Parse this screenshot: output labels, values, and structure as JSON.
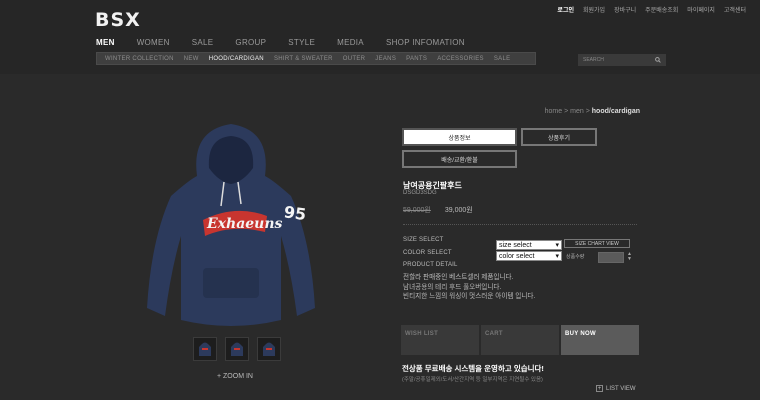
{
  "brand": "BSX",
  "util_links": [
    "로그인",
    "회원가입",
    "장바구니",
    "주문배송조회",
    "마이페이지",
    "고객센터"
  ],
  "main_nav": [
    "MEN",
    "WOMEN",
    "SALE",
    "GROUP",
    "STYLE",
    "MEDIA",
    "SHOP INFOMATION"
  ],
  "main_nav_active": "MEN",
  "sub_nav": [
    "WINTER COLLECTION",
    "NEW",
    "HOOD/CARDIGAN",
    "SHIRT & SWEATER",
    "OUTER",
    "JEANS",
    "PANTS",
    "ACCESSORIES",
    "SALE"
  ],
  "sub_nav_active": "HOOD/CARDIGAN",
  "search_placeholder": "SEARCH",
  "breadcrumb": {
    "home": "home",
    "sep": ">",
    "cat": "men",
    "current": "hood/cardigan"
  },
  "tabs": {
    "info": "상품정보",
    "review": "상품후기",
    "shipping": "배송/교환/환불"
  },
  "product": {
    "name": "남여공용긴팔후드",
    "code": "DSGD3SDG",
    "price_old": "59,000원",
    "price_new": "39,000원",
    "hood_text": "Exhaeuns",
    "sleeve_num": "95"
  },
  "options": {
    "size_label": "SIZE SELECT",
    "color_label": "COLOR SELECT",
    "detail_label": "PRODUCT DETAIL",
    "size_value": "size select",
    "color_value": "color select",
    "size_chart": "SIZE CHART VIEW",
    "qty_label": "상품수량"
  },
  "detail_lines": [
    "전할라 판매중인 베스트셀러 제품입니다.",
    "남녀공용의 테리 후드 풀오버입니다.",
    "빈티지한 느낌의 워싱이 멋스러운 아이템 입니다."
  ],
  "buttons": {
    "wish": "WISH LIST",
    "cart": "CART",
    "buy": "BUY NOW"
  },
  "shipping": {
    "title": "전상품 무료배송 시스템을 운영하고 있습니다!",
    "sub": "(주말/공휴일제외/도서/산간지역 등 일부지역은 지연될수 있음)"
  },
  "zoom": "+ ZOOM IN",
  "list_view": "LIST VIEW",
  "colors": {
    "background": "#2a2a2a",
    "hoodie": "#2c3a5c",
    "logo_red": "#c8352f"
  }
}
